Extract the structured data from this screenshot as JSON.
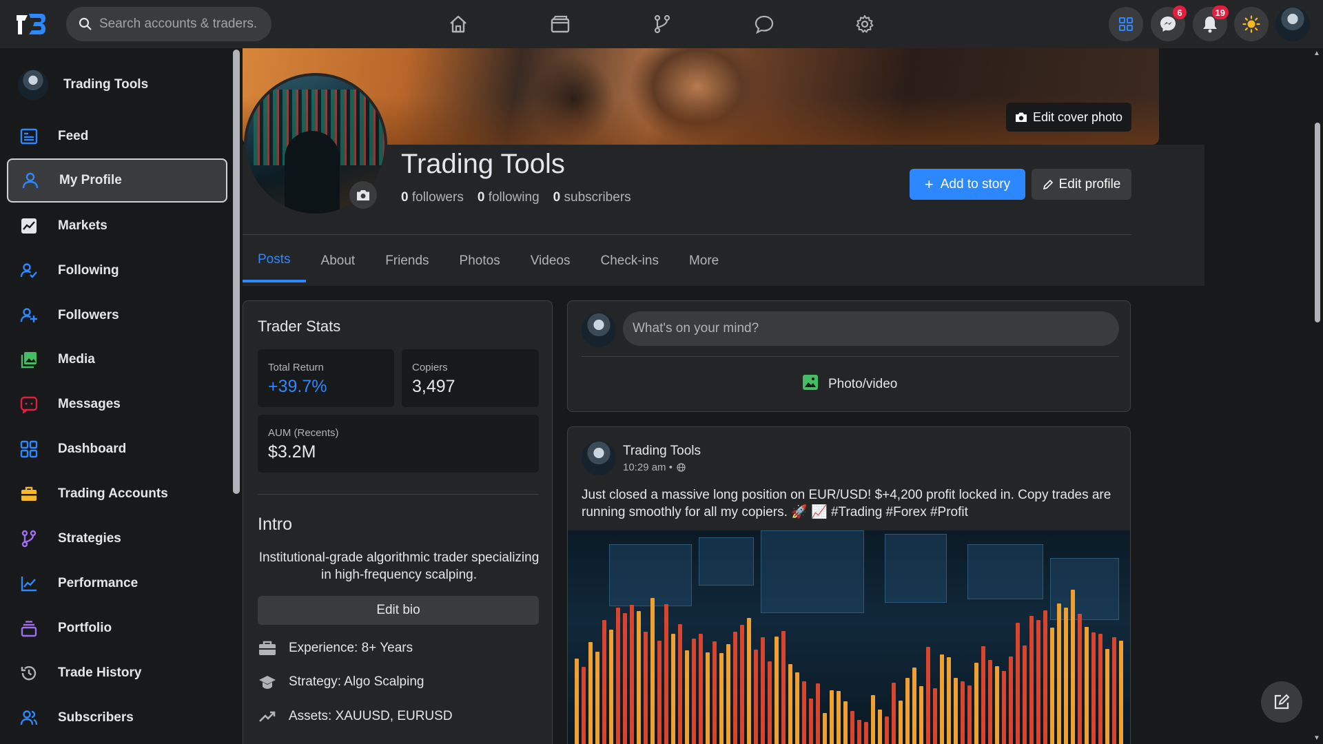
{
  "search": {
    "placeholder": "Search accounts & traders..."
  },
  "topbar": {
    "nav_icons": [
      "home-icon",
      "wallet-icon",
      "branch-icon",
      "chat-bubble-icon",
      "gear-icon"
    ],
    "messenger_badge": "6",
    "notifications_badge": "19"
  },
  "sidebar": {
    "profile_name": "Trading Tools",
    "items": [
      {
        "label": "Feed",
        "icon": "feed-icon",
        "color": "#2d88ff"
      },
      {
        "label": "My Profile",
        "icon": "user-icon",
        "color": "#2d88ff"
      },
      {
        "label": "Markets",
        "icon": "chart-box-icon",
        "color": "#e4e6eb"
      },
      {
        "label": "Following",
        "icon": "user-check-icon",
        "color": "#2d88ff"
      },
      {
        "label": "Followers",
        "icon": "user-plus-icon",
        "color": "#2d88ff"
      },
      {
        "label": "Media",
        "icon": "image-icon",
        "color": "#45bd62"
      },
      {
        "label": "Messages",
        "icon": "message-icon",
        "color": "#e41e3f"
      },
      {
        "label": "Dashboard",
        "icon": "grid-icon",
        "color": "#2d88ff"
      },
      {
        "label": "Trading Accounts",
        "icon": "briefcase-icon",
        "color": "#f7b928"
      },
      {
        "label": "Strategies",
        "icon": "branch-icon",
        "color": "#a06ef0"
      },
      {
        "label": "Performance",
        "icon": "line-chart-icon",
        "color": "#2d88ff"
      },
      {
        "label": "Portfolio",
        "icon": "stack-icon",
        "color": "#a06ef0"
      },
      {
        "label": "Trade History",
        "icon": "history-icon",
        "color": "#b0b3b8"
      },
      {
        "label": "Subscribers",
        "icon": "users-icon",
        "color": "#2d88ff"
      }
    ]
  },
  "cover": {
    "edit_label": "Edit cover photo"
  },
  "profile": {
    "name": "Trading Tools",
    "followers_count": "0",
    "followers_label": "followers",
    "following_count": "0",
    "following_label": "following",
    "subscribers_count": "0",
    "subscribers_label": "subscribers",
    "add_story_label": "Add to story",
    "edit_profile_label": "Edit profile"
  },
  "tabs": [
    {
      "label": "Posts",
      "active": true
    },
    {
      "label": "About"
    },
    {
      "label": "Friends"
    },
    {
      "label": "Photos"
    },
    {
      "label": "Videos"
    },
    {
      "label": "Check-ins"
    },
    {
      "label": "More"
    }
  ],
  "trader_stats": {
    "title": "Trader Stats",
    "total_return_label": "Total Return",
    "total_return_value": "+39.7%",
    "copiers_label": "Copiers",
    "copiers_value": "3,497",
    "aum_label": "AUM (Recents)",
    "aum_value": "$3.2M"
  },
  "intro": {
    "title": "Intro",
    "bio": "Institutional-grade algorithmic trader specializing in high-frequency scalping.",
    "edit_bio_label": "Edit bio",
    "experience": "Experience: 8+ Years",
    "strategy": "Strategy: Algo Scalping",
    "assets": "Assets: XAUUSD, EURUSD"
  },
  "composer": {
    "placeholder": "What's on your mind?",
    "photo_video_label": "Photo/video"
  },
  "post": {
    "author": "Trading Tools",
    "time": "10:29 am •",
    "text": "Just closed a massive long position on EUR/USD! $+4,200 profit locked in. Copy trades are running smoothly for all my copiers. 🚀 📈 #Trading #Forex #Profit"
  },
  "colors": {
    "accent": "#2d88ff",
    "surface": "#242526",
    "background": "#18191a"
  }
}
